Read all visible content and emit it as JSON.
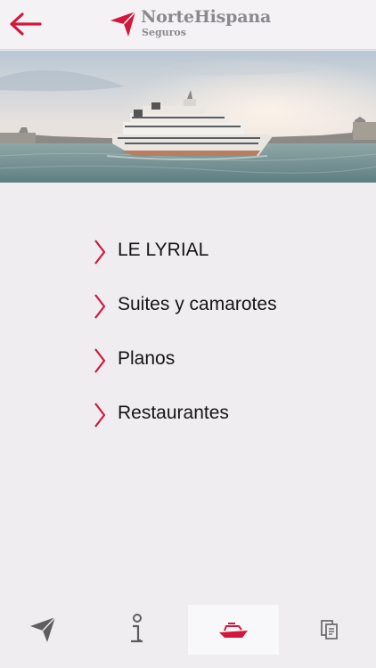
{
  "header": {
    "brand_name": "NorteHispana",
    "brand_sub": "Seguros",
    "back_icon": "arrow-left-icon",
    "accent_color": "#d2173c"
  },
  "hero": {
    "image": "cruise-ship-photo"
  },
  "menu": {
    "items": [
      {
        "label": "LE LYRIAL",
        "icon": "chevron-right-icon"
      },
      {
        "label": "Suites y camarotes",
        "icon": "chevron-right-icon"
      },
      {
        "label": "Planos",
        "icon": "chevron-right-icon"
      },
      {
        "label": "Restaurantes",
        "icon": "chevron-right-icon"
      }
    ]
  },
  "tabbar": {
    "tabs": [
      {
        "icon": "location-arrow-icon",
        "active": false
      },
      {
        "icon": "info-icon",
        "active": false
      },
      {
        "icon": "ship-icon",
        "active": true
      },
      {
        "icon": "documents-icon",
        "active": false
      }
    ]
  }
}
